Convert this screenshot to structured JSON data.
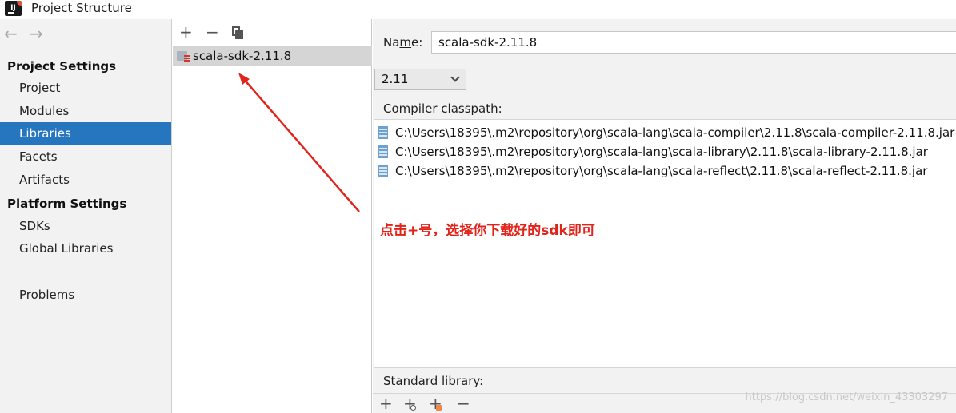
{
  "window": {
    "title": "Project Structure",
    "logo_text": "IJ"
  },
  "sidebar": {
    "back_icon": "←",
    "forward_icon": "→",
    "sections": [
      {
        "header": "Project Settings",
        "items": [
          {
            "label": "Project",
            "selected": false
          },
          {
            "label": "Modules",
            "selected": false
          },
          {
            "label": "Libraries",
            "selected": true
          },
          {
            "label": "Facets",
            "selected": false
          },
          {
            "label": "Artifacts",
            "selected": false
          }
        ]
      },
      {
        "header": "Platform Settings",
        "items": [
          {
            "label": "SDKs",
            "selected": false
          },
          {
            "label": "Global Libraries",
            "selected": false
          }
        ]
      }
    ],
    "problems_label": "Problems"
  },
  "library_list": {
    "toolbar": {
      "add_icon": "+",
      "remove_icon": "−",
      "copy_icon": "copy-icon"
    },
    "items": [
      {
        "name": "scala-sdk-2.11.8",
        "selected": true
      }
    ]
  },
  "details": {
    "name_label_before": "Na",
    "name_label_mnemonic": "m",
    "name_label_after": "e:",
    "name_value": "scala-sdk-2.11.8",
    "version_value": "2.11",
    "classpath_label": "Compiler classpath:",
    "classpath": [
      "C:\\Users\\18395\\.m2\\repository\\org\\scala-lang\\scala-compiler\\2.11.8\\scala-compiler-2.11.8.jar",
      "C:\\Users\\18395\\.m2\\repository\\org\\scala-lang\\scala-library\\2.11.8\\scala-library-2.11.8.jar",
      "C:\\Users\\18395\\.m2\\repository\\org\\scala-lang\\scala-reflect\\2.11.8\\scala-reflect-2.11.8.jar"
    ],
    "annotation": "点击+号，选择你下载好的sdk即可",
    "standard_library_label": "Standard library:",
    "bottom_toolbar": {
      "add_icon": "+",
      "remove_icon": "−"
    }
  },
  "watermark": "https://blog.csdn.net/weixin_43303297",
  "colors": {
    "selection": "#2675bf",
    "annotation": "#e2231a",
    "sidebar_bg": "#f2f2f2"
  }
}
